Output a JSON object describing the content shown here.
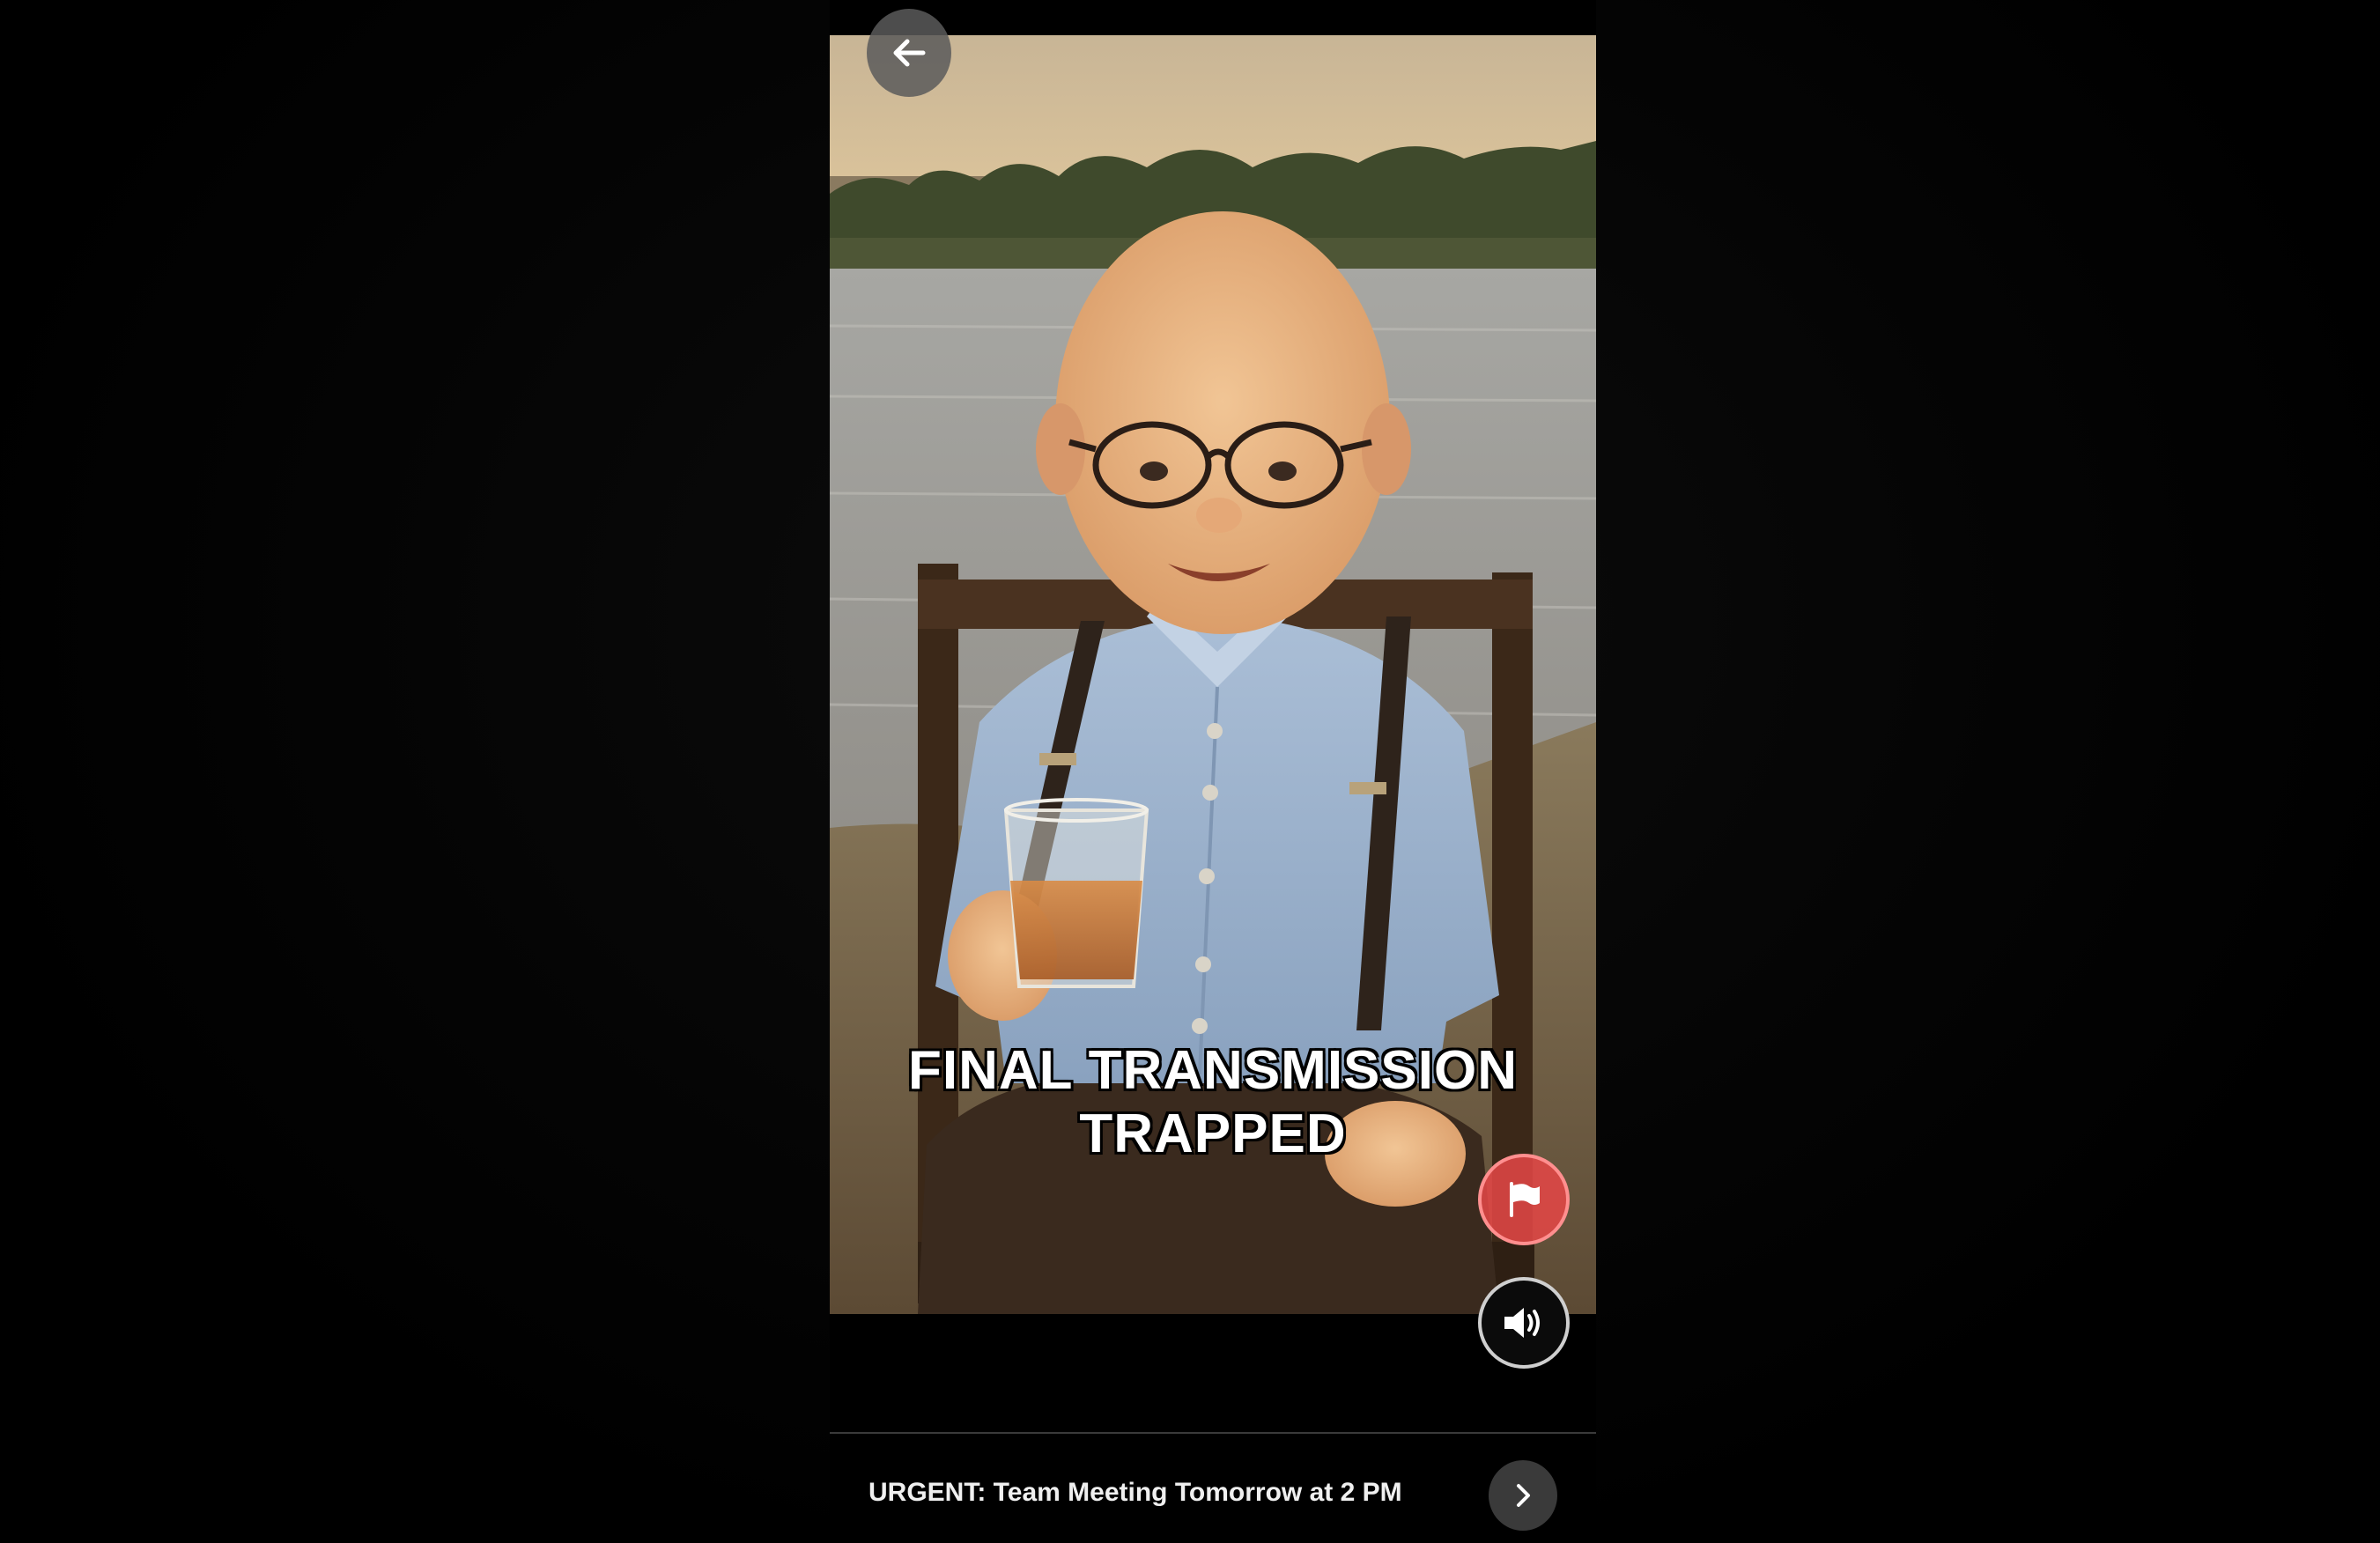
{
  "video": {
    "caption_line1": "FINAL TRANSMISSION",
    "caption_line2": "TRAPPED"
  },
  "controls": {
    "back_icon": "arrow-left-icon",
    "flag_icon": "flag-icon",
    "sound_icon": "speaker-on-icon",
    "next_icon": "chevron-right-icon"
  },
  "bottom": {
    "title": "URGENT: Team Meeting Tomorrow at 2 PM"
  },
  "colors": {
    "flag_accent": "#e64646",
    "background": "#000000"
  }
}
